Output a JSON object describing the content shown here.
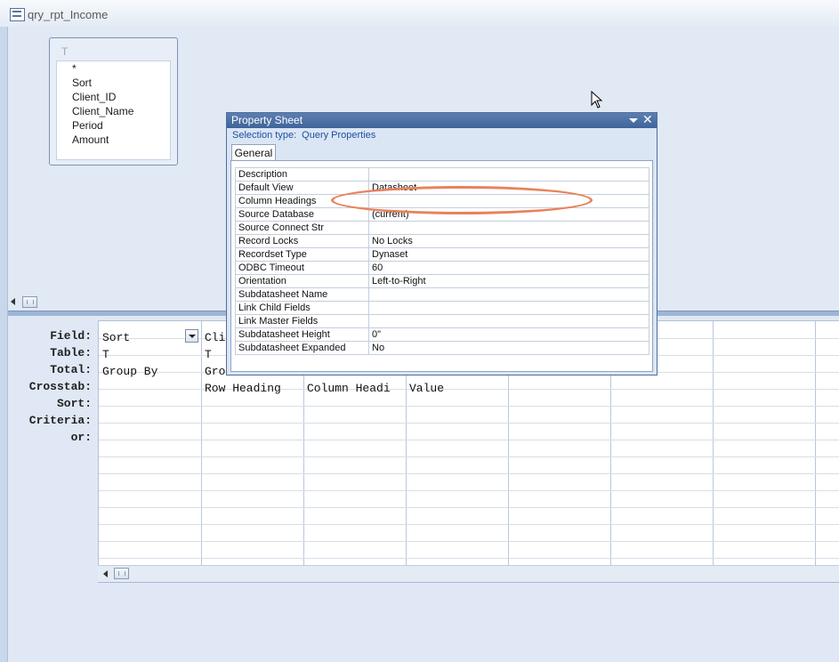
{
  "window": {
    "title": "qry_rpt_Income"
  },
  "table_box": {
    "title": "T",
    "fields": [
      "*",
      "Sort",
      "Client_ID",
      "Client_Name",
      "Period",
      "Amount"
    ]
  },
  "grid": {
    "row_labels": [
      "Field:",
      "Table:",
      "Total:",
      "Crosstab:",
      "Sort:",
      "Criteria:",
      "or:"
    ],
    "columns": [
      {
        "field": "Sort",
        "table": "T",
        "total": "Group By",
        "crosstab": ""
      },
      {
        "field": "Cli",
        "table": "T",
        "total": "Gro",
        "crosstab": "Row Heading"
      },
      {
        "field": "",
        "table": "",
        "total": "",
        "crosstab": "Column Headi"
      },
      {
        "field": "",
        "table": "",
        "total": "",
        "crosstab": "Value"
      }
    ]
  },
  "property_sheet": {
    "title": "Property Sheet",
    "selection_type_label": "Selection type:",
    "selection_type_value": "Query Properties",
    "tab": "General",
    "rows": [
      {
        "key": "Description",
        "value": ""
      },
      {
        "key": "Default View",
        "value": "Datasheet"
      },
      {
        "key": "Column Headings",
        "value": ""
      },
      {
        "key": "Source Database",
        "value": "(current)"
      },
      {
        "key": "Source Connect Str",
        "value": ""
      },
      {
        "key": "Record Locks",
        "value": "No Locks"
      },
      {
        "key": "Recordset Type",
        "value": "Dynaset"
      },
      {
        "key": "ODBC Timeout",
        "value": "60"
      },
      {
        "key": "Orientation",
        "value": "Left-to-Right"
      },
      {
        "key": "Subdatasheet Name",
        "value": ""
      },
      {
        "key": "Link Child Fields",
        "value": ""
      },
      {
        "key": "Link Master Fields",
        "value": ""
      },
      {
        "key": "Subdatasheet Height",
        "value": "0\""
      },
      {
        "key": "Subdatasheet Expanded",
        "value": "No"
      }
    ]
  },
  "annotation": {
    "color": "#e8825a"
  }
}
